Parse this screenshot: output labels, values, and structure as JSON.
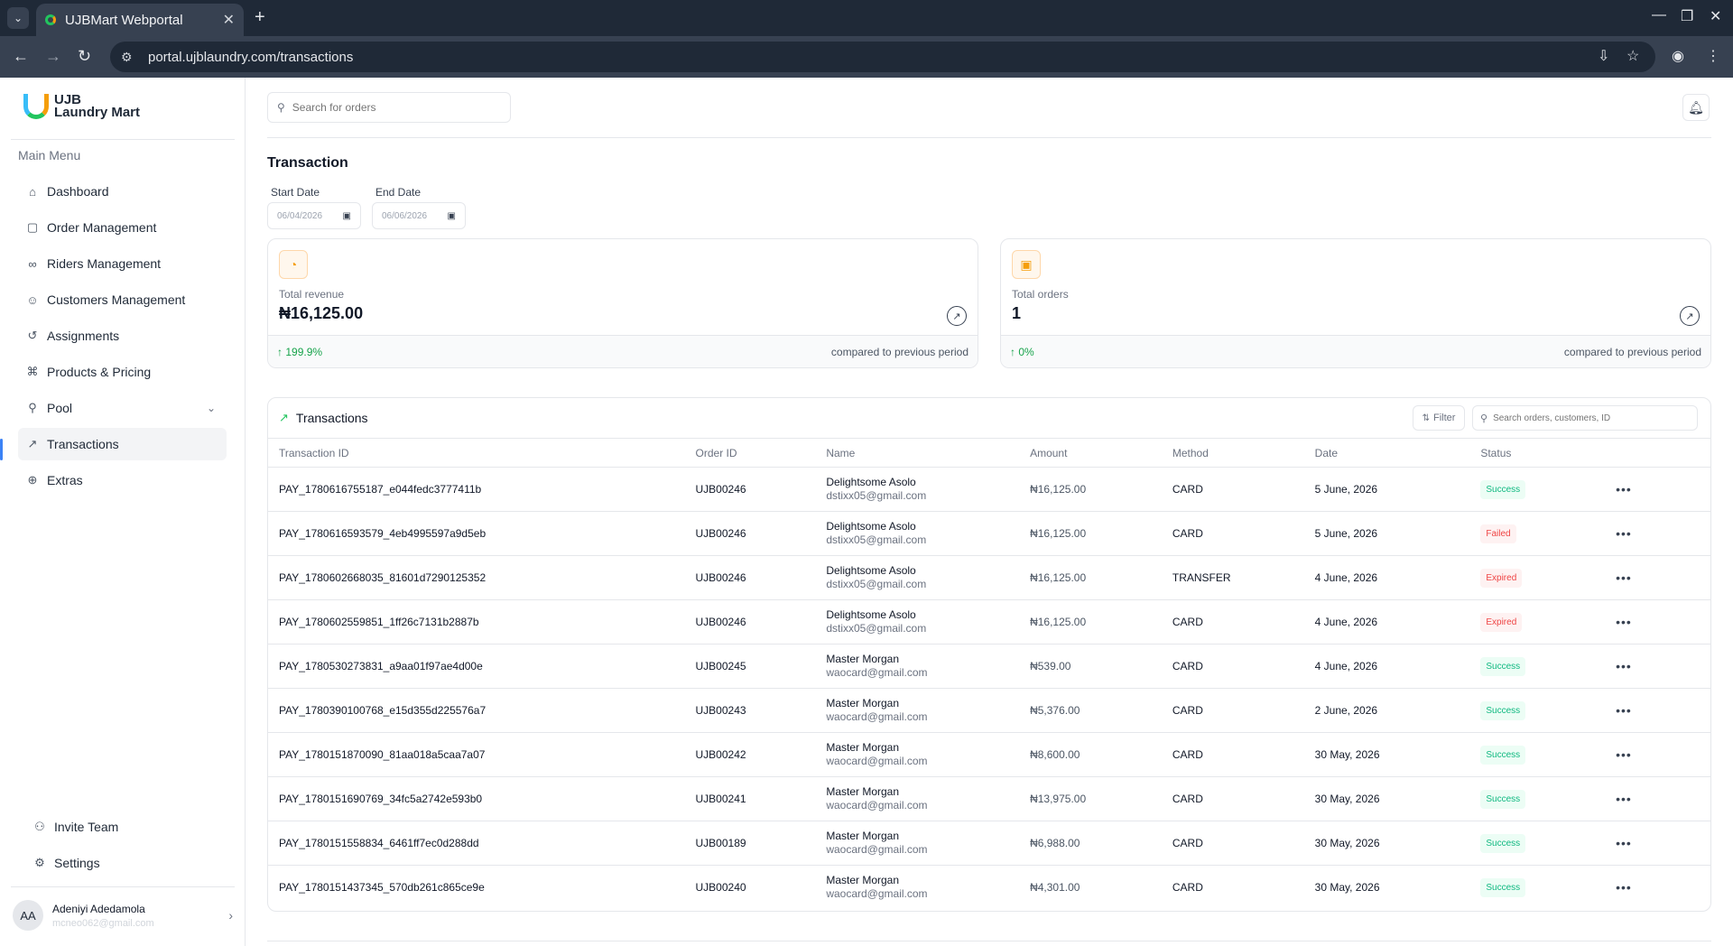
{
  "browser": {
    "tab_title": "UJBMart Webportal",
    "url": "portal.ujblaundry.com/transactions"
  },
  "sidebar": {
    "logo_line1": "UJB",
    "logo_line2": "Laundry Mart",
    "menu_title": "Main Menu",
    "items": [
      {
        "label": "Dashboard",
        "icon": "home-icon"
      },
      {
        "label": "Order Management",
        "icon": "bag-icon"
      },
      {
        "label": "Riders Management",
        "icon": "bike-icon"
      },
      {
        "label": "Customers Management",
        "icon": "users-icon"
      },
      {
        "label": "Assignments",
        "icon": "history-icon"
      },
      {
        "label": "Products & Pricing",
        "icon": "tag-icon"
      },
      {
        "label": "Pool",
        "icon": "pool-icon"
      },
      {
        "label": "Transactions",
        "icon": "chart-icon"
      },
      {
        "label": "Extras",
        "icon": "globe-icon"
      }
    ],
    "active_item": "Transactions",
    "bottom_items": [
      {
        "label": "Invite Team",
        "icon": "user-plus-icon"
      },
      {
        "label": "Settings",
        "icon": "gear-icon"
      }
    ],
    "user": {
      "initials": "AA",
      "name": "Adeniyi Adedamola",
      "email": "mcneo062@gmail.com"
    }
  },
  "header": {
    "search_placeholder": "Search for orders"
  },
  "page": {
    "title": "Transaction",
    "start_date_label": "Start Date",
    "start_date_value": "06/04/2026",
    "end_date_label": "End Date",
    "end_date_value": "06/06/2026"
  },
  "stats": [
    {
      "label": "Total revenue",
      "value": "₦16,125.00",
      "change": "199.9%",
      "compare": "compared to previous period",
      "icon": "piggy-bank-icon"
    },
    {
      "label": "Total orders",
      "value": "1",
      "change": "0%",
      "compare": "compared to previous period",
      "icon": "shopping-bag-icon"
    }
  ],
  "transactions": {
    "title": "Transactions",
    "filter_label": "Filter",
    "search_placeholder": "Search orders, customers, ID",
    "columns": [
      "Transaction ID",
      "Order ID",
      "Name",
      "Amount",
      "Method",
      "Date",
      "Status"
    ],
    "rows": [
      {
        "id": "PAY_1780616755187_e044fedc3777411b",
        "order": "UJB00246",
        "name": "Delightsome Asolo",
        "email": "dstixx05@gmail.com",
        "amount": "₦16,125.00",
        "method": "CARD",
        "date": "5 June, 2026",
        "status": "Success"
      },
      {
        "id": "PAY_1780616593579_4eb4995597a9d5eb",
        "order": "UJB00246",
        "name": "Delightsome Asolo",
        "email": "dstixx05@gmail.com",
        "amount": "₦16,125.00",
        "method": "CARD",
        "date": "5 June, 2026",
        "status": "Failed"
      },
      {
        "id": "PAY_1780602668035_81601d7290125352",
        "order": "UJB00246",
        "name": "Delightsome Asolo",
        "email": "dstixx05@gmail.com",
        "amount": "₦16,125.00",
        "method": "TRANSFER",
        "date": "4 June, 2026",
        "status": "Expired"
      },
      {
        "id": "PAY_1780602559851_1ff26c7131b2887b",
        "order": "UJB00246",
        "name": "Delightsome Asolo",
        "email": "dstixx05@gmail.com",
        "amount": "₦16,125.00",
        "method": "CARD",
        "date": "4 June, 2026",
        "status": "Expired"
      },
      {
        "id": "PAY_1780530273831_a9aa01f97ae4d00e",
        "order": "UJB00245",
        "name": "Master Morgan",
        "email": "waocard@gmail.com",
        "amount": "₦539.00",
        "method": "CARD",
        "date": "4 June, 2026",
        "status": "Success"
      },
      {
        "id": "PAY_1780390100768_e15d355d225576a7",
        "order": "UJB00243",
        "name": "Master Morgan",
        "email": "waocard@gmail.com",
        "amount": "₦5,376.00",
        "method": "CARD",
        "date": "2 June, 2026",
        "status": "Success"
      },
      {
        "id": "PAY_1780151870090_81aa018a5caa7a07",
        "order": "UJB00242",
        "name": "Master Morgan",
        "email": "waocard@gmail.com",
        "amount": "₦8,600.00",
        "method": "CARD",
        "date": "30 May, 2026",
        "status": "Success"
      },
      {
        "id": "PAY_1780151690769_34fc5a2742e593b0",
        "order": "UJB00241",
        "name": "Master Morgan",
        "email": "waocard@gmail.com",
        "amount": "₦13,975.00",
        "method": "CARD",
        "date": "30 May, 2026",
        "status": "Success"
      },
      {
        "id": "PAY_1780151558834_6461ff7ec0d288dd",
        "order": "UJB00189",
        "name": "Master Morgan",
        "email": "waocard@gmail.com",
        "amount": "₦6,988.00",
        "method": "CARD",
        "date": "30 May, 2026",
        "status": "Success"
      },
      {
        "id": "PAY_1780151437345_570db261c865ce9e",
        "order": "UJB00240",
        "name": "Master Morgan",
        "email": "waocard@gmail.com",
        "amount": "₦4,301.00",
        "method": "CARD",
        "date": "30 May, 2026",
        "status": "Success"
      }
    ]
  },
  "colors": {
    "accent": "#3b82f6",
    "success": "#10b981",
    "danger": "#ef4444",
    "positive_change": "#16a34a"
  }
}
